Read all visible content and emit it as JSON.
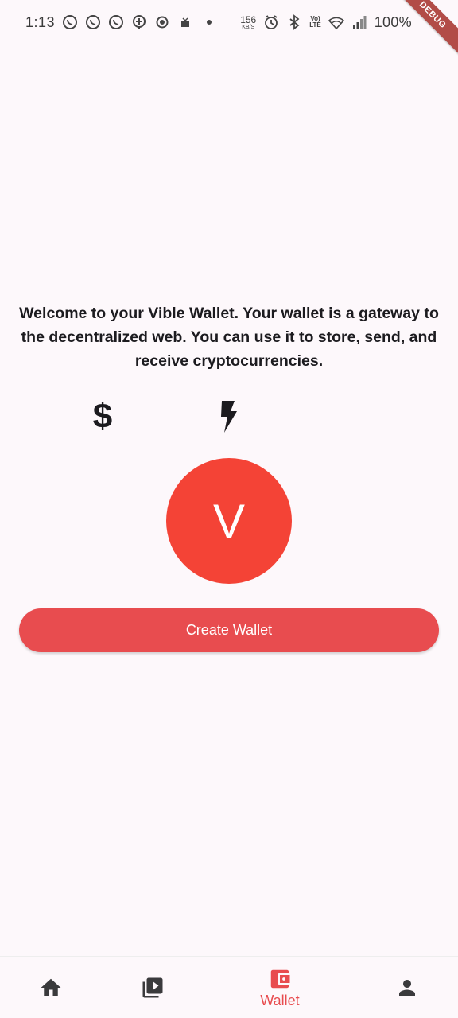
{
  "status_bar": {
    "time": "1:13",
    "speed_value": "156",
    "speed_unit": "KB/S",
    "volte_top": "Vo)",
    "volte_bottom": "LTE",
    "battery": "100%"
  },
  "debug_banner": "DEBUG",
  "welcome_text": "Welcome to your Vible Wallet. Your wallet is a gateway to the decentralized web. You can use it to store, send, and receive cryptocurrencies.",
  "feature_icons": {
    "dollar": "$",
    "names": [
      "dollar-icon",
      "bolt-icon",
      "moon-icon"
    ]
  },
  "avatar_letter": "V",
  "create_button_label": "Create Wallet",
  "bottom_nav": {
    "active": "wallet",
    "wallet_label": "Wallet"
  },
  "colors": {
    "accent": "#e84c4f",
    "avatar": "#f44336",
    "background": "#fdf8fb",
    "debug_ribbon": "#b24c47"
  }
}
